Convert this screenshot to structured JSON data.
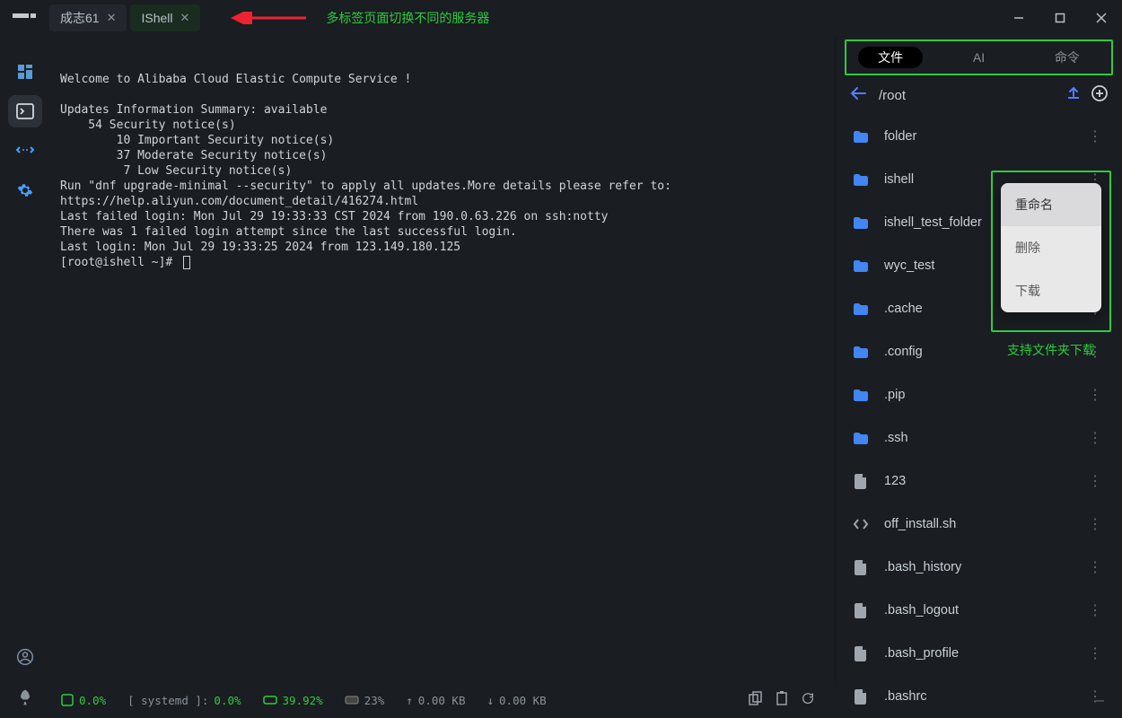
{
  "tabs": [
    {
      "label": "成志61",
      "active": false
    },
    {
      "label": "IShell",
      "active": true
    }
  ],
  "annotation_tabs": "多标签页面切换不同的服务器",
  "terminal_text": "Welcome to Alibaba Cloud Elastic Compute Service !\n\nUpdates Information Summary: available\n    54 Security notice(s)\n        10 Important Security notice(s)\n        37 Moderate Security notice(s)\n         7 Low Security notice(s)\nRun \"dnf upgrade-minimal --security\" to apply all updates.More details please refer to:\nhttps://help.aliyun.com/document_detail/416274.html\nLast failed login: Mon Jul 29 19:33:33 CST 2024 from 190.0.63.226 on ssh:notty\nThere was 1 failed login attempt since the last successful login.\nLast login: Mon Jul 29 19:33:25 2024 from 123.149.180.125",
  "prompt": "[root@ishell ~]# ",
  "right": {
    "tabs": [
      "文件",
      "AI",
      "命令"
    ],
    "active_tab": 0,
    "path": "/root",
    "files": [
      {
        "type": "folder",
        "name": "folder"
      },
      {
        "type": "folder",
        "name": "ishell"
      },
      {
        "type": "folder",
        "name": "ishell_test_folder"
      },
      {
        "type": "folder",
        "name": "wyc_test"
      },
      {
        "type": "folder",
        "name": ".cache"
      },
      {
        "type": "folder",
        "name": ".config"
      },
      {
        "type": "folder",
        "name": ".pip"
      },
      {
        "type": "folder",
        "name": ".ssh"
      },
      {
        "type": "file",
        "name": "123"
      },
      {
        "type": "code",
        "name": "off_install.sh"
      },
      {
        "type": "file",
        "name": ".bash_history"
      },
      {
        "type": "file",
        "name": ".bash_logout"
      },
      {
        "type": "file",
        "name": ".bash_profile"
      },
      {
        "type": "file",
        "name": ".bashrc"
      }
    ]
  },
  "context_menu": {
    "items": [
      "重命名",
      "删除",
      "下载"
    ],
    "highlighted": 0
  },
  "context_annotation": "支持文件夹下载",
  "status": {
    "cpu_icon": "",
    "cpu": "0.0%",
    "systemd_label": "[ systemd ]:",
    "systemd": "0.0%",
    "disk_icon": "",
    "disk": "39.92%",
    "mem_icon": "",
    "mem": "23%",
    "up": "0.00 KB",
    "down": "0.00 KB"
  }
}
